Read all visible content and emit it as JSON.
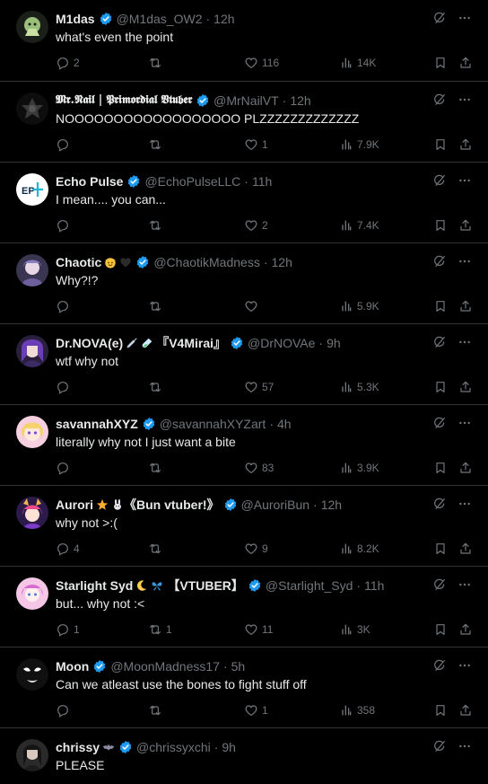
{
  "colors": {
    "background": "#000000",
    "text": "#e7e9ea",
    "muted": "#71767b",
    "verified": "#1d9bf0",
    "divider": "#2f3336"
  },
  "icons": {
    "reply": "reply-icon",
    "repost": "repost-icon",
    "like": "like-icon",
    "views": "views-icon",
    "bookmark": "bookmark-icon",
    "share": "share-icon",
    "grok": "grok-icon",
    "more": "more-icon"
  },
  "tweets": [
    {
      "name": "M1das",
      "handle": "@M1das_OW2",
      "time": "12h",
      "text": "what's even the point",
      "replies": "2",
      "reposts": "",
      "likes": "116",
      "views": "14K"
    },
    {
      "name": "𝕸𝖗.𝕹𝖆𝖎𝖑 | 𝕻𝖗𝖎𝖒𝖔𝖗𝖉𝖎𝖆𝖑 𝖁𝖙𝖚𝖇𝖊𝖗",
      "handle": "@MrNailVT",
      "time": "12h",
      "text": "NOOOOOOOOOOOOOOOOOO PLZZZZZZZZZZZZZ",
      "replies": "",
      "reposts": "",
      "likes": "1",
      "views": "7.9K"
    },
    {
      "name": "Echo Pulse",
      "handle": "@EchoPulseLLC",
      "time": "11h",
      "text": "I mean.... you can...",
      "replies": "",
      "reposts": "",
      "likes": "2",
      "views": "7.4K"
    },
    {
      "name": "Chaotic",
      "handle": "@ChaotikMadness",
      "time": "12h",
      "text": "Why?!?",
      "replies": "",
      "reposts": "",
      "likes": "",
      "views": "5.9K"
    },
    {
      "name": "Dr.NOVA(e)",
      "name_suffix": "『V4Mirai』",
      "handle": "@DrNOVAe",
      "time": "9h",
      "text": "wtf why not",
      "replies": "",
      "reposts": "",
      "likes": "57",
      "views": "5.3K"
    },
    {
      "name": "savannahXYZ",
      "handle": "@savannahXYZart",
      "time": "4h",
      "text": "literally why not I just want a bite",
      "replies": "",
      "reposts": "",
      "likes": "83",
      "views": "3.9K"
    },
    {
      "name": "Aurori",
      "name_suffix": "《Bun vtuber!》",
      "handle": "@AuroriBun",
      "time": "12h",
      "text": "why not >:(",
      "replies": "4",
      "reposts": "",
      "likes": "9",
      "views": "8.2K"
    },
    {
      "name": "Starlight Syd",
      "name_suffix": "【VTUBER】",
      "handle": "@Starlight_Syd",
      "time": "11h",
      "text": "but... why not :<",
      "replies": "1",
      "reposts": "1",
      "likes": "11",
      "views": "3K"
    },
    {
      "name": "Moon",
      "handle": "@MoonMadness17",
      "time": "5h",
      "text": "Can we atleast use the bones to fight stuff off",
      "replies": "",
      "reposts": "",
      "likes": "1",
      "views": "358"
    },
    {
      "name": "chrissy",
      "handle": "@chrissyxchi",
      "time": "9h",
      "text": "PLEASE",
      "replies": "",
      "reposts": "",
      "likes": "",
      "views": ""
    }
  ]
}
